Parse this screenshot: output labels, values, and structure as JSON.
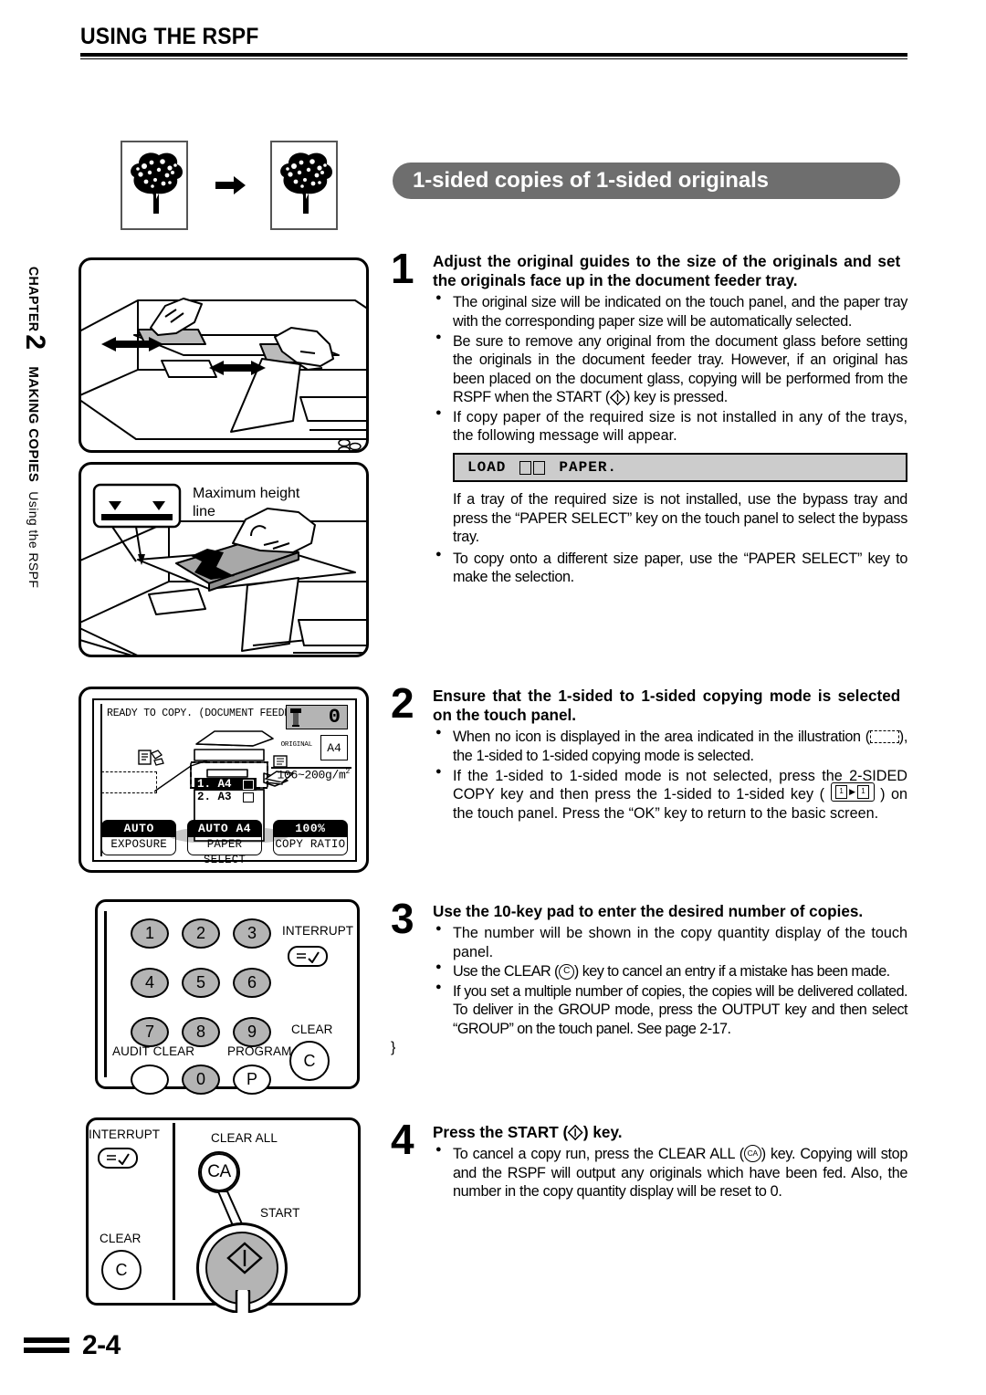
{
  "header": {
    "title": "USING THE RSPF"
  },
  "chapter_tab": {
    "chapter_word": "CHAPTER",
    "chapter_number": "2",
    "section": "MAKING COPIES",
    "subsection": "Using the RSPF"
  },
  "banner": {
    "text": "1-sided copies of 1-sided originals"
  },
  "illustrations": {
    "tree_caption": "original-to-copy-tree-diagram",
    "max_height_label_line1": "Maximum height",
    "max_height_label_line2": "line"
  },
  "touch_panel": {
    "status_text": "READY TO COPY. (DOCUMENT FEEDER MODE)",
    "copy_count": "0",
    "original_label": "ORIGINAL",
    "original_size": "A4",
    "paper_weight": "106~200g/m",
    "paper_weight_sup": "2",
    "trays": [
      {
        "label": "1. A4",
        "selected": true
      },
      {
        "label": "2. A3",
        "selected": false
      }
    ],
    "buttons": [
      {
        "value": "AUTO",
        "label": "EXPOSURE"
      },
      {
        "value": "AUTO A4",
        "label": "PAPER SELECT"
      },
      {
        "value": "100%",
        "label": "COPY RATIO"
      }
    ]
  },
  "keypad": {
    "keys": [
      "1",
      "2",
      "3",
      "4",
      "5",
      "6",
      "7",
      "8",
      "9",
      "0"
    ],
    "interrupt_label": "INTERRUPT",
    "clear_label": "CLEAR",
    "clear_key": "C",
    "audit_clear_label": "AUDIT CLEAR",
    "program_label": "PROGRAM",
    "program_key": "P"
  },
  "start_panel": {
    "interrupt_label": "INTERRUPT",
    "clear_label": "CLEAR",
    "clear_key": "C",
    "clear_all_label": "CLEAR ALL",
    "clear_all_key": "CA",
    "start_label": "START"
  },
  "steps": [
    {
      "number": "1",
      "heading": "Adjust the original guides to the size of the originals and set the originals face up in the document feeder tray.",
      "bullets": [
        "The original size will be indicated on the touch panel, and the paper tray with the corresponding paper size will be automatically selected.",
        "Be sure to remove any original from the document glass before setting the originals in the document feeder tray. However, if an original has been placed on the document glass, copying will be performed from the RSPF when the START (◇) key is pressed.",
        "If copy paper of the required size is not installed in any of the trays, the following message will appear."
      ],
      "lcd_message_prefix": "LOAD",
      "lcd_message_suffix": "PAPER.",
      "sub_paragraph": "If a tray of the required size is not installed, use the bypass tray and press the “PAPER SELECT” key on the touch panel to select the bypass tray.",
      "trailing_bullet": "To copy onto a different size paper, use the “PAPER SELECT” key to make the selection."
    },
    {
      "number": "2",
      "heading": "Ensure that the 1-sided to 1-sided copying mode is selected on the touch panel.",
      "bullet_2a_pre": "When no icon is displayed in the area indicated in the illustration (",
      "bullet_2a_post": "), the 1-sided to 1-sided copying mode is selected.",
      "bullet_2b_pre": "If the 1-sided to 1-sided mode is not selected, press the 2-SIDED COPY key and then press the 1-sided to 1-sided key (",
      "bullet_2b_post": ") on the touch panel. Press the “OK” key to return to the basic screen."
    },
    {
      "number": "3",
      "heading": "Use the 10-key pad to enter the desired number of copies.",
      "bullet_3a": "The number will be shown in the copy quantity display of the touch panel.",
      "bullet_3b_pre": "Use the CLEAR (",
      "bullet_3b_key": "C",
      "bullet_3b_post": ") key to cancel an entry if a mistake has been made.",
      "bullet_3c": "If you set a multiple number of copies, the copies will be delivered collated. To deliver in the GROUP mode, press the OUTPUT key and then select “GROUP” on the touch panel. See page 2-17."
    },
    {
      "number": "4",
      "heading_pre": "Press the START (",
      "heading_post": ") key.",
      "bullet_4a_pre": "To cancel a copy run, press the CLEAR ALL (",
      "bullet_4a_key": "CA",
      "bullet_4a_post": ") key. Copying will stop and the RSPF will output any originals which have been fed. Also, the number in the copy quantity display will be reset to 0."
    }
  ],
  "footer": {
    "page_number": "2-4"
  }
}
